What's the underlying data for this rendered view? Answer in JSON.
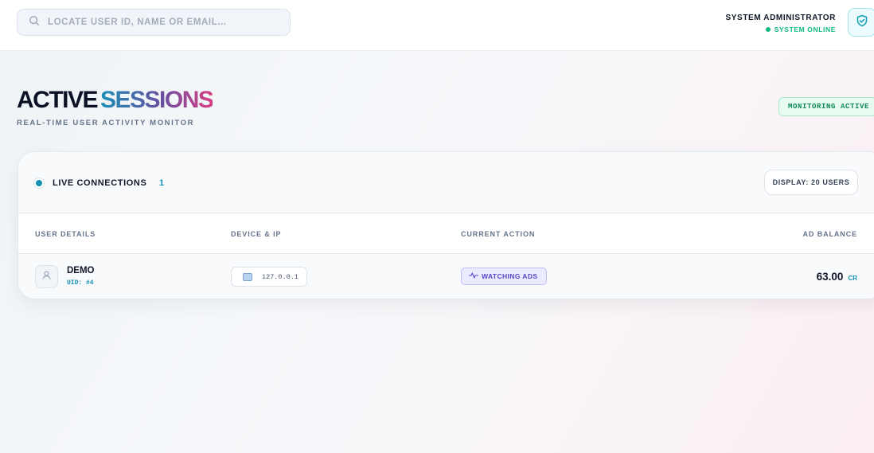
{
  "search": {
    "placeholder": "LOCATE USER ID, NAME OR EMAIL...",
    "value": ""
  },
  "header": {
    "admin_name": "SYSTEM ADMINISTRATOR",
    "admin_status": "SYSTEM ONLINE"
  },
  "page": {
    "title_part1": "ACTIVE",
    "title_part2": "SESSIONS",
    "subtitle": "REAL-TIME USER ACTIVITY MONITOR",
    "badge": "MONITORING ACTIVE"
  },
  "panel": {
    "live_label": "LIVE CONNECTIONS",
    "live_count": "1",
    "display_button": "DISPLAY: 20 USERS",
    "columns": [
      "USER DETAILS",
      "DEVICE & IP",
      "CURRENT ACTION",
      "AD BALANCE"
    ],
    "rows": [
      {
        "name": "DEMO",
        "uid": "UID: #4",
        "ip": "127.0.0.1",
        "action": "WATCHING ADS",
        "balance": "63.00",
        "unit": "CR"
      }
    ]
  },
  "colors": {
    "accent": "#1590b3",
    "online": "#10b981",
    "action": "#5548c8"
  },
  "icons": [
    "search-icon",
    "shield-icon",
    "user-icon",
    "device-icon",
    "activity-icon"
  ]
}
